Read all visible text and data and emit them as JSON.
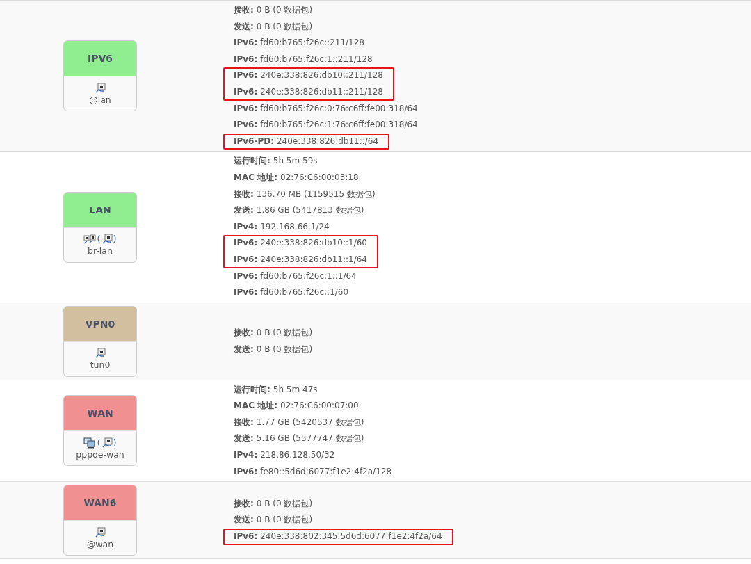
{
  "interfaces": [
    {
      "name": "IPV6",
      "color": "#90ee90",
      "icons": [
        {
          "kind": "port"
        }
      ],
      "device": "@lan",
      "groups": [
        {
          "highlighted": false,
          "lines": [
            {
              "label": "接收:",
              "value": "0 B (0 数据包)"
            },
            {
              "label": "发送:",
              "value": "0 B (0 数据包)"
            },
            {
              "label": "IPv6:",
              "value": "fd60:b765:f26c::211/128"
            },
            {
              "label": "IPv6:",
              "value": "fd60:b765:f26c:1::211/128"
            }
          ]
        },
        {
          "highlighted": true,
          "lines": [
            {
              "label": "IPv6:",
              "value": "240e:338:826:db10::211/128"
            },
            {
              "label": "IPv6:",
              "value": "240e:338:826:db11::211/128"
            }
          ]
        },
        {
          "highlighted": false,
          "lines": [
            {
              "label": "IPv6:",
              "value": "fd60:b765:f26c:0:76:c6ff:fe00:318/64"
            },
            {
              "label": "IPv6:",
              "value": "fd60:b765:f26c:1:76:c6ff:fe00:318/64"
            }
          ]
        },
        {
          "highlighted": true,
          "lines": [
            {
              "label": "IPv6-PD:",
              "value": "240e:338:826:db11::/64"
            }
          ]
        }
      ]
    },
    {
      "name": "LAN",
      "color": "#90ee90",
      "icons": [
        {
          "kind": "bridge"
        },
        {
          "kind": "text",
          "text": "("
        },
        {
          "kind": "port"
        },
        {
          "kind": "text",
          "text": ")"
        }
      ],
      "device": "br-lan",
      "groups": [
        {
          "highlighted": false,
          "lines": [
            {
              "label": "运行时间:",
              "value": "5h 5m 59s"
            },
            {
              "label": "MAC 地址:",
              "value": "02:76:C6:00:03:18"
            },
            {
              "label": "接收:",
              "value": "136.70 MB (1159515 数据包)"
            },
            {
              "label": "发送:",
              "value": "1.86 GB (5417813 数据包)"
            },
            {
              "label": "IPv4:",
              "value": "192.168.66.1/24"
            }
          ]
        },
        {
          "highlighted": true,
          "lines": [
            {
              "label": "IPv6:",
              "value": "240e:338:826:db10::1/60"
            },
            {
              "label": "IPv6:",
              "value": "240e:338:826:db11::1/64"
            }
          ]
        },
        {
          "highlighted": false,
          "lines": [
            {
              "label": "IPv6:",
              "value": "fd60:b765:f26c:1::1/64"
            },
            {
              "label": "IPv6:",
              "value": "fd60:b765:f26c::1/60"
            }
          ]
        }
      ]
    },
    {
      "name": "VPN0",
      "color": "#d2bf9f",
      "icons": [
        {
          "kind": "port"
        }
      ],
      "device": "tun0",
      "groups": [
        {
          "highlighted": false,
          "lines": [
            {
              "label": "接收:",
              "value": "0 B (0 数据包)"
            },
            {
              "label": "发送:",
              "value": "0 B (0 数据包)"
            }
          ]
        }
      ]
    },
    {
      "name": "WAN",
      "color": "#f09090",
      "icons": [
        {
          "kind": "computers"
        },
        {
          "kind": "text",
          "text": "("
        },
        {
          "kind": "port"
        },
        {
          "kind": "text",
          "text": ")"
        }
      ],
      "device": "pppoe-wan",
      "groups": [
        {
          "highlighted": false,
          "lines": [
            {
              "label": "运行时间:",
              "value": "5h 5m 47s"
            },
            {
              "label": "MAC 地址:",
              "value": "02:76:C6:00:07:00"
            },
            {
              "label": "接收:",
              "value": "1.77 GB (5420537 数据包)"
            },
            {
              "label": "发送:",
              "value": "5.16 GB (5577747 数据包)"
            },
            {
              "label": "IPv4:",
              "value": "218.86.128.50/32"
            },
            {
              "label": "IPv6:",
              "value": "fe80::5d6d:6077:f1e2:4f2a/128"
            }
          ]
        }
      ]
    },
    {
      "name": "WAN6",
      "color": "#f09090",
      "icons": [
        {
          "kind": "port"
        }
      ],
      "device": "@wan",
      "groups": [
        {
          "highlighted": false,
          "lines": [
            {
              "label": "接收:",
              "value": "0 B (0 数据包)"
            },
            {
              "label": "发送:",
              "value": "0 B (0 数据包)"
            }
          ]
        },
        {
          "highlighted": true,
          "lines": [
            {
              "label": "IPv6:",
              "value": "240e:338:802:345:5d6d:6077:f1e2:4f2a/64"
            }
          ]
        }
      ]
    }
  ]
}
